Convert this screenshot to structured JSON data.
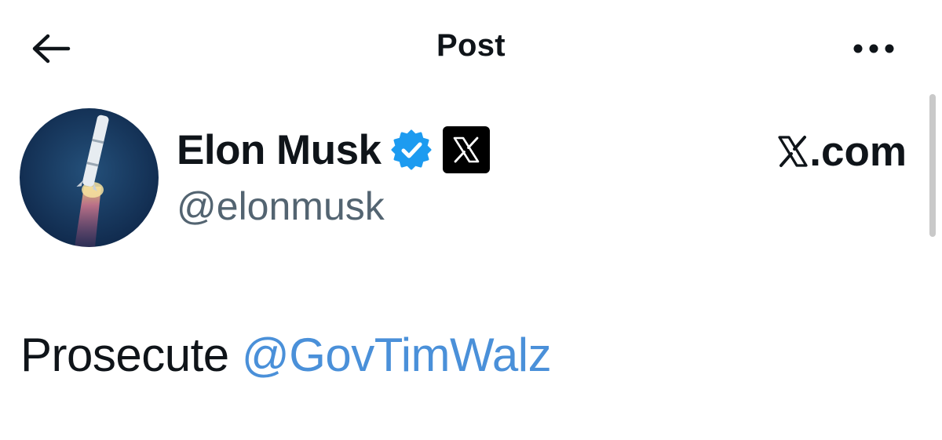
{
  "header": {
    "title": "Post",
    "back_icon": "arrow-left-icon",
    "more_icon": "ellipsis-icon"
  },
  "author": {
    "display_name": "Elon Musk",
    "handle": "@elonmusk",
    "verified_icon": "verified-badge-icon",
    "affiliate_badge_icon": "x-logo-icon",
    "avatar": "rocket-launch-avatar"
  },
  "affiliation": {
    "label": ".com",
    "icon": "x-logo-icon"
  },
  "post": {
    "text": "Prosecute",
    "mention": "@GovTimWalz"
  },
  "colors": {
    "text": "#0f1419",
    "handle": "#536471",
    "mention": "#4a90d9",
    "verified": "#1d9bf0",
    "badge": "#000000"
  }
}
